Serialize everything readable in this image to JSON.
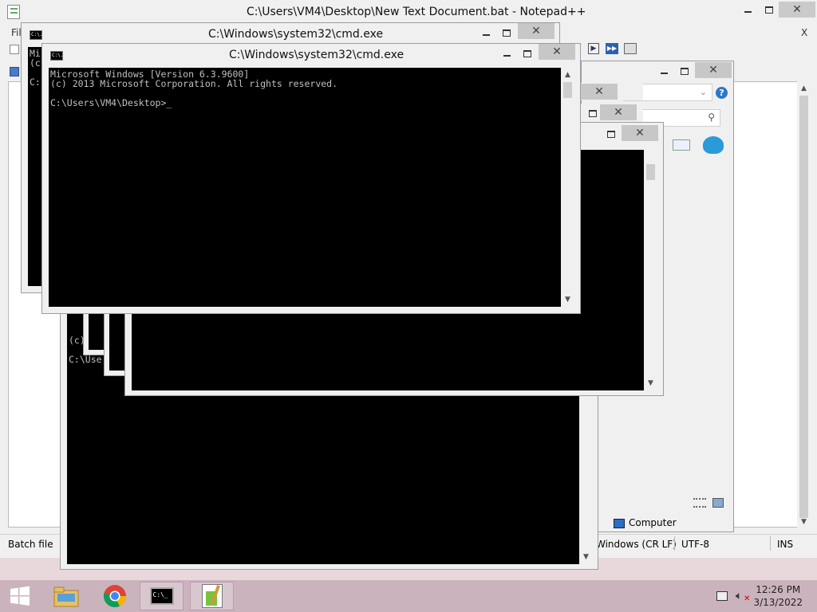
{
  "notepad": {
    "title": "C:\\Users\\VM4\\Desktop\\New Text Document.bat - Notepad++",
    "menu_first": "Fil",
    "close_x": "X",
    "status": {
      "file_type": "Batch file",
      "eol": "Windows (CR LF)",
      "encoding": "UTF-8",
      "mode": "INS"
    }
  },
  "explorer": {
    "status_computer": "Computer"
  },
  "cmd_back": {
    "title": "C:\\Windows\\system32\\cmd.exe",
    "lines": [
      "Mi",
      "(c",
      "",
      "C:"
    ]
  },
  "cmd_front": {
    "title": "C:\\Windows\\system32\\cmd.exe",
    "lines": [
      "Microsoft Windows [Version 6.3.9600]",
      "(c) 2013 Microsoft Corporation. All rights reserved.",
      "",
      "C:\\Users\\VM4\\Desktop>_"
    ]
  },
  "cmd_lower": {
    "lines": [
      "(c)",
      "",
      "C:\\Use"
    ]
  },
  "cmd_icon_text": "C:\\.",
  "taskbar": {
    "items": [
      "start-button",
      "file-explorer",
      "chrome",
      "command-prompt",
      "notepad-plus-plus"
    ],
    "time": "12:26 PM",
    "date": "3/13/2022"
  }
}
